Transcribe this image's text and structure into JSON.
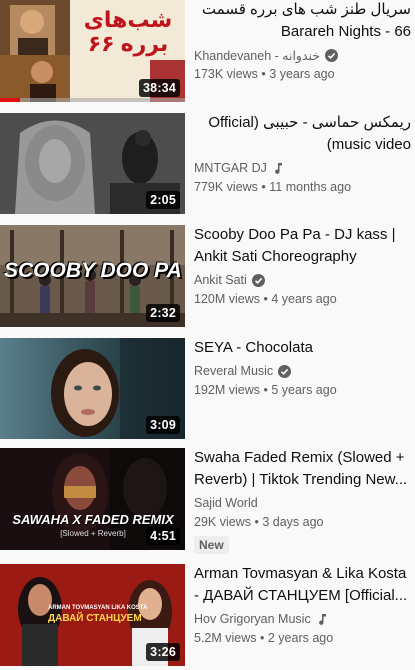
{
  "videos": [
    {
      "title": "سریال طنز شب های برره قسمت 66 - Barareh Nights",
      "channel": "Khandevaneh - خندوانه",
      "verified": true,
      "music_note": false,
      "views": "173K views",
      "age": "3 years ago",
      "duration": "38:34",
      "watched_fraction": 0.11,
      "thumb_text": "شب‌های برره ۶۶"
    },
    {
      "title": "ریمکس حماسی - حبیبی (Official music video)",
      "channel": "MNTGAR DJ",
      "verified": false,
      "music_note": true,
      "views": "779K views",
      "age": "11 months ago",
      "duration": "2:05"
    },
    {
      "title": "Scooby Doo Pa Pa - DJ kass | Ankit Sati Choreography",
      "channel": "Ankit Sati",
      "verified": true,
      "music_note": false,
      "views": "120M views",
      "age": "4 years ago",
      "duration": "2:32",
      "thumb_text": "SCOOBY DOO PA PA"
    },
    {
      "title": "SEYA - Chocolata",
      "channel": "Reveral Music",
      "verified": true,
      "music_note": false,
      "views": "192M views",
      "age": "5 years ago",
      "duration": "3:09"
    },
    {
      "title": "Swaha Faded Remix (Slowed + Reverb) | Tiktok Trending New...",
      "channel": "Sajid World",
      "verified": false,
      "music_note": false,
      "views": "29K views",
      "age": "3 days ago",
      "duration": "4:51",
      "badge": "New",
      "thumb_text": "SAWAHA X FADED REMIX",
      "thumb_subtext": "[Slowed + Reverb]"
    },
    {
      "title": "Arman Tovmasyan & Lika Kosta - ДАВАЙ СТАНЦУЕМ [Official...",
      "channel": "Hov Grigoryan Music",
      "verified": false,
      "music_note": true,
      "views": "5.2M views",
      "age": "2 years ago",
      "duration": "3:26",
      "thumb_text": "ДАВАЙ СТАНЦУЕМ",
      "thumb_subtext": "ARMAN TOVMASYAN  LIKA KOSTA"
    }
  ],
  "separator": " • ",
  "colors": {
    "progress": "#e01010",
    "meta": "#606060"
  }
}
